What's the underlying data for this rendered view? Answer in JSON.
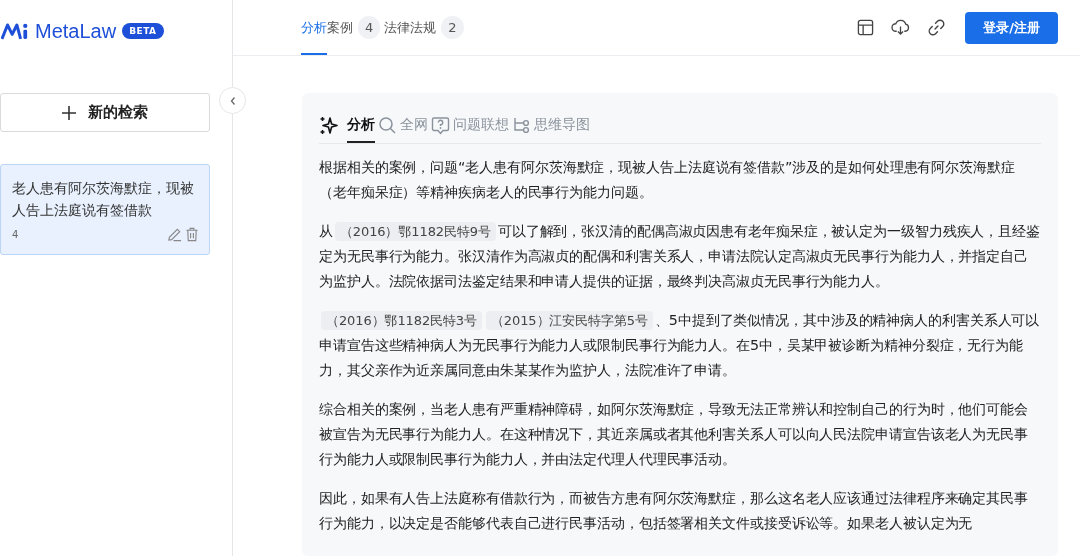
{
  "brand": {
    "name": "MetaLaw",
    "badge": "BETA"
  },
  "sidebar": {
    "new_search": "新的检索",
    "history": [
      {
        "title": "老人患有阿尔茨海默症，现被人告上法庭说有签借款",
        "count": "4",
        "selected": true
      }
    ]
  },
  "tabs": [
    {
      "label": "分析",
      "selected": true
    },
    {
      "label": "案例",
      "count": "4",
      "selected": false
    },
    {
      "label": "法律法规",
      "count": "2",
      "selected": false
    }
  ],
  "toolbar": {
    "login": "登录/注册"
  },
  "subtabs": [
    {
      "label": "分析",
      "kind": "sparkle",
      "selected": true
    },
    {
      "label": "全网",
      "kind": "search",
      "selected": false
    },
    {
      "label": "问题联想",
      "kind": "question",
      "selected": false
    },
    {
      "label": "思维导图",
      "kind": "mindmap",
      "selected": false
    }
  ],
  "paragraphs": [
    [
      {
        "kind": "text",
        "text": "根据相关的案例，问题“老人患有阿尔茨海默症，现被人告上法庭说有签借款”涉及的是如何处理患有阿尔茨海默症（老年痴呆症）等精神疾病老人的民事行为能力问题。"
      }
    ],
    [
      {
        "kind": "text",
        "text": "从"
      },
      {
        "kind": "citation",
        "text": "（2016）鄂1182民特9号"
      },
      {
        "kind": "text",
        "text": "可以了解到，张汉清的配偶高淑贞因患有老年痴呆症，被认定为一级智力残疾人，且经鉴定为无民事行为能力。张汉清作为高淑贞的配偶和利害关系人，申请法院认定高淑贞无民事行为能力人，并指定自己为监护人。法院依据司法鉴定结果和申请人提供的证据，最终判决高淑贞无民事行为能力人。"
      }
    ],
    [
      {
        "kind": "citation",
        "text": "（2016）鄂1182民特3号"
      },
      {
        "kind": "citation",
        "text": "（2015）江安民特字第5号"
      },
      {
        "kind": "text",
        "text": "、5中提到了类似情况，其中涉及的精神病人的利害关系人可以申请宣告这些精神病人为无民事行为能力人或限制民事行为能力人。在5中，吴某甲被诊断为精神分裂症，无行为能力，其父亲作为近亲属同意由朱某某作为监护人，法院准许了申请。"
      }
    ],
    [
      {
        "kind": "text",
        "text": "综合相关的案例，当老人患有严重精神障碍，如阿尔茨海默症，导致无法正常辨认和控制自己的行为时，他们可能会被宣告为无民事行为能力人。在这种情况下，其近亲属或者其他利害关系人可以向人民法院申请宣告该老人为无民事行为能力人或限制民事行为能力人，并由法定代理人代理民事活动。"
      }
    ],
    [
      {
        "kind": "text",
        "text": "因此，如果有人告上法庭称有借款行为，而被告方患有阿尔茨海默症，那么这名老人应该通过法律程序来确定其民事行为能力，以决定是否能够代表自己进行民事活动，包括签署相关文件或接受诉讼等。如果老人被认定为无"
      }
    ]
  ]
}
